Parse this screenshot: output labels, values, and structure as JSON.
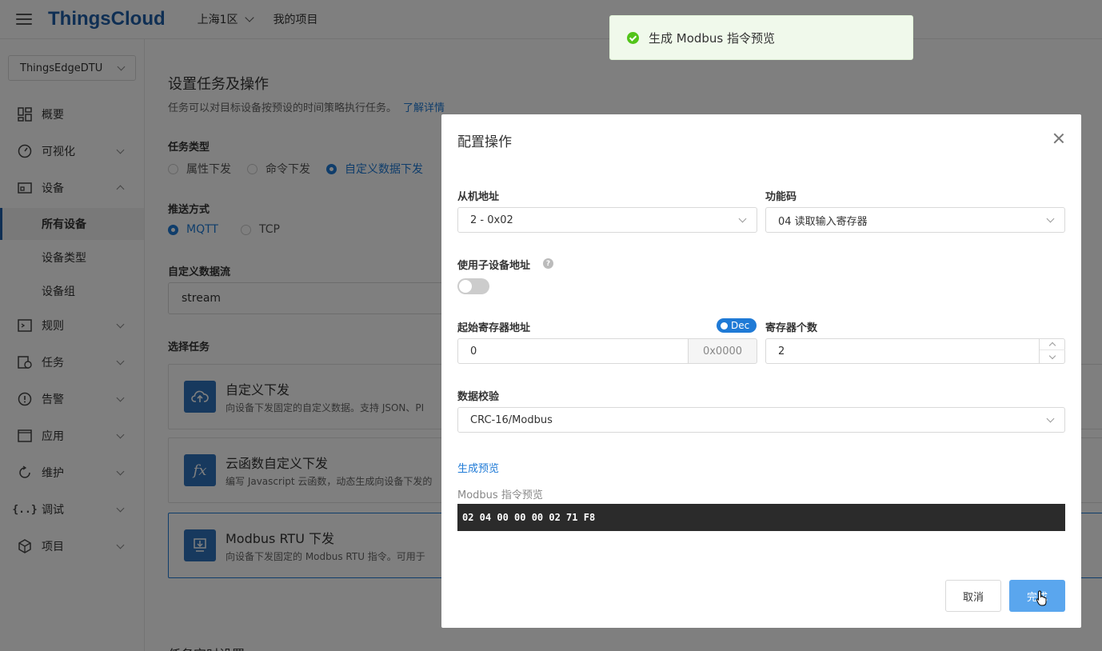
{
  "topbar": {
    "logo": "ThingsCloud",
    "region": "上海1区",
    "project": "我的项目"
  },
  "sidebar": {
    "device_select": "ThingsEdgeDTU",
    "items": [
      {
        "label": "概要",
        "icon": "dashboard-icon"
      },
      {
        "label": "可视化",
        "icon": "gauge-icon"
      },
      {
        "label": "设备",
        "icon": "device-icon"
      },
      {
        "label": "规则",
        "icon": "terminal-icon"
      },
      {
        "label": "任务",
        "icon": "task-icon"
      },
      {
        "label": "告警",
        "icon": "alert-icon"
      },
      {
        "label": "应用",
        "icon": "app-icon"
      },
      {
        "label": "维护",
        "icon": "maintenance-icon"
      },
      {
        "label": "调试",
        "icon": "debug-icon"
      },
      {
        "label": "项目",
        "icon": "project-icon"
      }
    ],
    "device_subitems": [
      "所有设备",
      "设备类型",
      "设备组"
    ]
  },
  "main": {
    "title": "设置任务及操作",
    "desc": "任务可以对目标设备按预设的时间策略执行任务。",
    "desc_link": "了解详情",
    "task_type_label": "任务类型",
    "task_types": [
      "属性下发",
      "命令下发",
      "自定义数据下发"
    ],
    "push_label": "推送方式",
    "push_types": [
      "MQTT",
      "TCP"
    ],
    "stream_label": "自定义数据流",
    "stream_value": "stream",
    "select_task_label": "选择任务",
    "cards": [
      {
        "title": "自定义下发",
        "desc": "向设备下发固定的自定义数据。支持 JSON、PI"
      },
      {
        "title": "云函数自定义下发",
        "desc": "编写 Javascript 云函数，动态生成向设备下发的"
      },
      {
        "title": "Modbus RTU 下发",
        "desc": "向设备下发固定的 Modbus RTU 指令。可用于"
      }
    ],
    "bottom_title": "任务定时设置"
  },
  "modal": {
    "title": "配置操作",
    "slave_label": "从机地址",
    "slave_value": "2 - 0x02",
    "func_label": "功能码",
    "func_value": "04 读取输入寄存器",
    "subaddr_label": "使用子设备地址",
    "subaddr_enabled": false,
    "start_label": "起始寄存器地址",
    "dec_badge": "Dec",
    "start_value": "0",
    "start_hex": "0x0000",
    "count_label": "寄存器个数",
    "count_value": "2",
    "check_label": "数据校验",
    "check_value": "CRC-16/Modbus",
    "gen_link": "生成预览",
    "preview_label": "Modbus 指令预览",
    "preview_value": "02 04 00 00 00 02 71 F8",
    "cancel": "取消",
    "ok": "完成"
  },
  "toast": {
    "message": "生成 Modbus 指令预览"
  }
}
